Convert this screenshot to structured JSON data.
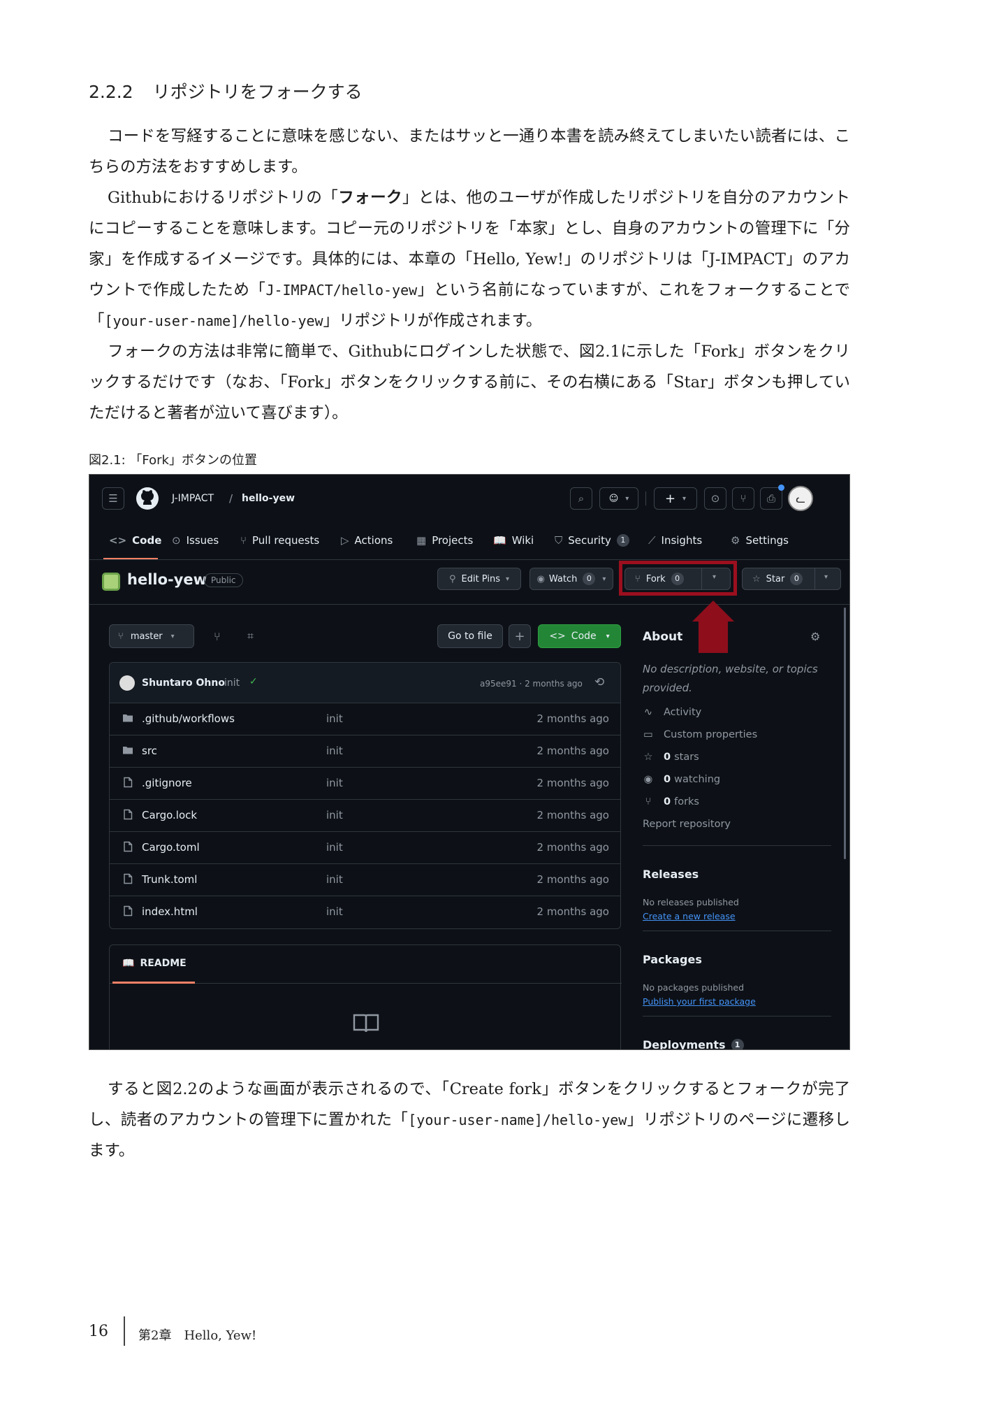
{
  "section": {
    "number": "2.2.2",
    "title": "リポジトリをフォークする"
  },
  "paragraphs": {
    "p1": "コードを写経することに意味を感じない、またはサッと一通り本書を読み終えてしまいたい読者には、こちらの方法をおすすめします。",
    "p2_a": "Githubにおけるリポジトリの「",
    "p2_b": "フォーク",
    "p2_c": "」とは、他のユーザが作成したリポジトリを自分のアカウントにコピーすることを意味します。コピー元のリポジトリを「本家」とし、自身のアカウントの管理下に「分家」を作成するイメージです。具体的には、本章の「Hello, Yew!」のリポジトリは「J-IMPACT」のアカウントで作成したため「",
    "p2_code1": "J-IMPACT/hello-yew",
    "p2_d": "」という名前になっていますが、これをフォークすることで「",
    "p2_code2": "[your-user-name]/hello-yew",
    "p2_e": "」リポジトリが作成されます。",
    "p3": "フォークの方法は非常に簡単で、Githubにログインした状態で、図2.1に示した「Fork」ボタンをクリックするだけです（なお、「Fork」ボタンをクリックする前に、その右横にある「Star」ボタンも押していただけると著者が泣いて喜びます）。",
    "p4_a": "すると図2.2のような画面が表示されるので、「Create fork」ボタンをクリックするとフォークが完了し、読者のアカウントの管理下に置かれた「",
    "p4_code": "[your-user-name]/hello-yew",
    "p4_b": "」リポジトリのページに遷移します。"
  },
  "figure": {
    "caption": "図2.1: 「Fork」ボタンの位置"
  },
  "github": {
    "owner": "J-IMPACT",
    "separator": "/",
    "repo": "hello-yew",
    "tabs": [
      {
        "label": "Code",
        "icon": "<>"
      },
      {
        "label": "Issues",
        "icon": "⊙"
      },
      {
        "label": "Pull requests",
        "icon": "⑂"
      },
      {
        "label": "Actions",
        "icon": "▷"
      },
      {
        "label": "Projects",
        "icon": "▦"
      },
      {
        "label": "Wiki",
        "icon": "📖"
      },
      {
        "label": "Security",
        "icon": "⛉",
        "count": "1"
      },
      {
        "label": "Insights",
        "icon": "⟋"
      },
      {
        "label": "Settings",
        "icon": "⚙"
      }
    ],
    "visibility": "Public",
    "edit_pins": "Edit Pins",
    "watch": {
      "label": "Watch",
      "count": "0"
    },
    "fork": {
      "label": "Fork",
      "count": "0"
    },
    "star": {
      "label": "Star",
      "count": "0"
    },
    "branch": "master",
    "go_to_file": "Go to file",
    "add": "+",
    "code_btn": "Code",
    "commit": {
      "author": "Shuntaro Ohno",
      "message": "init",
      "meta": "a95ee91 · 2 months ago"
    },
    "files": [
      {
        "name": ".github/workflows",
        "type": "folder",
        "msg": "init",
        "age": "2 months ago"
      },
      {
        "name": "src",
        "type": "folder",
        "msg": "init",
        "age": "2 months ago"
      },
      {
        "name": ".gitignore",
        "type": "file",
        "msg": "init",
        "age": "2 months ago"
      },
      {
        "name": "Cargo.lock",
        "type": "file",
        "msg": "init",
        "age": "2 months ago"
      },
      {
        "name": "Cargo.toml",
        "type": "file",
        "msg": "init",
        "age": "2 months ago"
      },
      {
        "name": "Trunk.toml",
        "type": "file",
        "msg": "init",
        "age": "2 months ago"
      },
      {
        "name": "index.html",
        "type": "file",
        "msg": "init",
        "age": "2 months ago"
      }
    ],
    "readme": "README",
    "about": {
      "title": "About",
      "description": "No description, website, or topics provided.",
      "activity": "Activity",
      "custom_properties": "Custom properties",
      "stars_count": "0",
      "stars_label": "stars",
      "watching_count": "0",
      "watching_label": "watching",
      "forks_count": "0",
      "forks_label": "forks",
      "report": "Report repository"
    },
    "releases": {
      "title": "Releases",
      "note": "No releases published",
      "link": "Create a new release"
    },
    "packages": {
      "title": "Packages",
      "note": "No packages published",
      "link": "Publish your first package"
    },
    "deployments": {
      "title": "Deployments",
      "count": "1"
    },
    "colors": {
      "bg": "#0d1117",
      "accent_green": "#238636",
      "highlight": "#9b0f1f"
    }
  },
  "footer": {
    "page": "16",
    "chapter": "第2章　Hello, Yew!"
  }
}
